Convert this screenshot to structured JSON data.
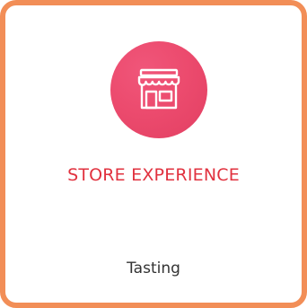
{
  "card": {
    "title": "STORE EXPERIENCE",
    "subtitle": "Tasting",
    "icon": "store-icon"
  },
  "colors": {
    "border": "#f28e57",
    "icon_circle": "#ec4b6e",
    "title": "#e1323f",
    "subtitle": "#333333"
  }
}
